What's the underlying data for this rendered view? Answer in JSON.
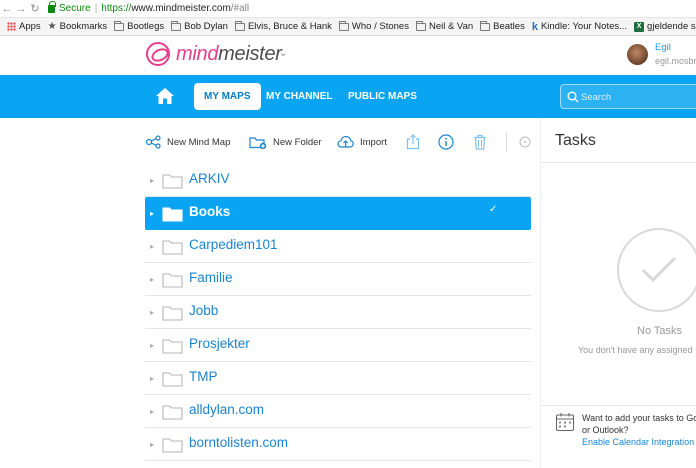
{
  "browser": {
    "secure_label": "Secure",
    "url_scheme": "https://",
    "url_host": "www.mindmeister.com",
    "url_path": "/#all",
    "bookmarks": [
      {
        "label": "Apps",
        "icon": "apps-grid-icon"
      },
      {
        "label": "Bookmarks",
        "icon": "star-icon"
      },
      {
        "label": "Bootlegs",
        "icon": "folder-icon"
      },
      {
        "label": "Bob Dylan",
        "icon": "folder-icon"
      },
      {
        "label": "Elvis, Bruce & Hank",
        "icon": "folder-icon"
      },
      {
        "label": "Who / Stones",
        "icon": "folder-icon"
      },
      {
        "label": "Neil & Van",
        "icon": "folder-icon"
      },
      {
        "label": "Beatles",
        "icon": "folder-icon"
      },
      {
        "label": "Kindle: Your Notes...",
        "icon": "kindle-icon"
      },
      {
        "label": "gjeldende software...",
        "icon": "excel-icon"
      }
    ]
  },
  "header": {
    "logo_prefix": "mind",
    "logo_suffix": "meister",
    "user_name": "Egil",
    "user_email": "egil.mosbr"
  },
  "nav": {
    "tabs": [
      {
        "label": "MY MAPS",
        "active": true
      },
      {
        "label": "MY CHANNEL",
        "active": false
      },
      {
        "label": "PUBLIC MAPS",
        "active": false
      }
    ],
    "search_placeholder": "Search"
  },
  "toolbar": {
    "new_mind_map": "New Mind Map",
    "new_folder": "New Folder",
    "import": "Import"
  },
  "folders": [
    {
      "label": "ARKIV",
      "selected": false
    },
    {
      "label": "Books",
      "selected": true
    },
    {
      "label": "Carpediem101",
      "selected": false
    },
    {
      "label": "Familie",
      "selected": false
    },
    {
      "label": "Jobb",
      "selected": false
    },
    {
      "label": "Prosjekter",
      "selected": false
    },
    {
      "label": "TMP",
      "selected": false
    },
    {
      "label": "alldylan.com",
      "selected": false
    },
    {
      "label": "borntolisten.com",
      "selected": false
    }
  ],
  "tasks": {
    "title": "Tasks",
    "empty_title": "No Tasks",
    "empty_sub": "You don't have any assigned",
    "cal_promo_line1": "Want to add your tasks to Go",
    "cal_promo_line2": "or Outlook?",
    "cal_link": "Enable Calendar Integration"
  },
  "colors": {
    "accent": "#0aa5f2",
    "brand_pink": "#e53e8b",
    "link_blue": "#1a84cf"
  }
}
